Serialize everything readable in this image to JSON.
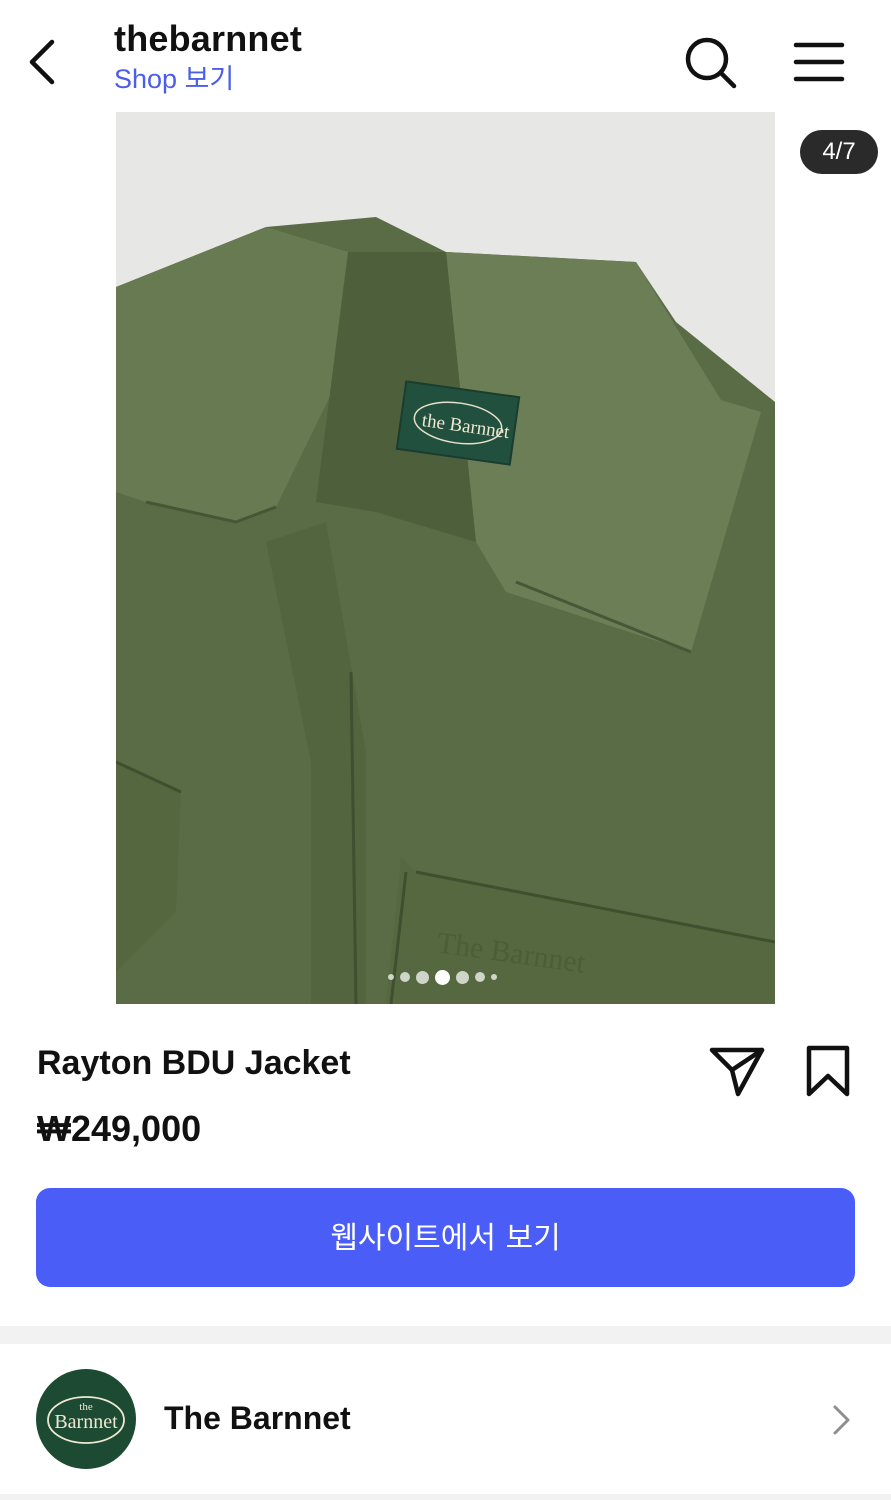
{
  "header": {
    "title": "thebarnnet",
    "subtitle": "Shop 보기",
    "icons": [
      "back-chevron-icon",
      "search-icon",
      "menu-icon"
    ]
  },
  "gallery": {
    "counter": "4/7",
    "current_index": 4,
    "total": 7,
    "label_text": "the Barnnet",
    "embroidery_text": "The Barnnet"
  },
  "product": {
    "name": "Rayton BDU Jacket",
    "price": "₩249,000",
    "cta_label": "웹사이트에서 보기",
    "icons": [
      "share-icon",
      "bookmark-icon"
    ]
  },
  "brand": {
    "name": "The Barnnet",
    "logo_small": "the",
    "logo_main": "Barnnet"
  },
  "colors": {
    "accent": "#4a5ef7",
    "link": "#4a5ee8",
    "jacket": "#5b6e45",
    "brand_green": "#1d4a33"
  }
}
